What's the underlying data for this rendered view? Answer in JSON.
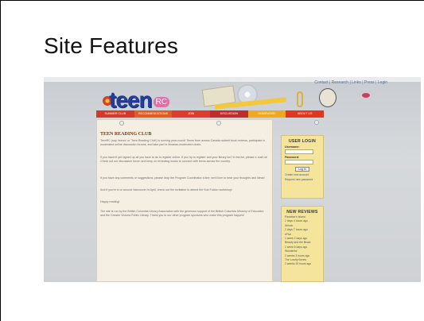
{
  "slide": {
    "title": "Site Features"
  },
  "website": {
    "utility_links": "Contact | Research | Links | Press | Login",
    "logo": {
      "word": "teen",
      "tag": "RC"
    },
    "nav_tabs": [
      {
        "label": "SUMMER CLUB",
        "color": "#d43a2a"
      },
      {
        "label": "RECOMMENDATIONS",
        "color": "#e15c22"
      },
      {
        "label": "JOIN",
        "color": "#de3a2e"
      },
      {
        "label": "DISCUSSION",
        "color": "#c02c2c"
      },
      {
        "label": "HOMEWORK",
        "color": "#f0a81e"
      },
      {
        "label": "ABOUT US",
        "color": "#e2371f"
      }
    ],
    "main": {
      "heading": "TEEN READING CLUB",
      "paragraphs": [
        "TeenRC (say 'teenrc' or 'Teen Reading Club') is running year-round! Teens from across Canada submit book reviews, participate in moderated online discussion forums, and take part in librarian-moderated chats.",
        "If you haven't yet signed up all you have to do is register online. If you try to register and your library isn't in the list, please e-mail us! Check out our discussion forum and keep on reviewing books to connect with teens across the country.",
        "If you have any comments or suggestions, please drop the Program Coordinator a line; we'd love to hear your thoughts and ideas!",
        "And if you're in or around Vancouver in April, check out the invitation to attend the Sub Fusion workshop!",
        "Happy reading!",
        "The site is run by the British Columbia Library Association with the generous support of the British Columbia Ministry of Education and the Greater Victoria Public Library. Thank you to our other program sponsors who make this program happen!"
      ]
    },
    "login": {
      "title": "USER LOGIN",
      "username_label": "Username:",
      "password_label": "Password:",
      "button": "Log in",
      "links": [
        "Create new account",
        "Request new password"
      ]
    },
    "reviews": {
      "title": "NEW REVIEWS",
      "items": [
        "Paradise's Island",
        "2 days 4 hours ago",
        "Airlock",
        "2 days 7 hours ago",
        "eFive",
        "1 week 2 days ago",
        "Beauty and the Beast",
        "1 week 6 days ago",
        "Wonderful",
        "2 weeks 3 hours ago",
        "The Lovely Bones",
        "2 weeks 19 hours ago"
      ]
    }
  }
}
